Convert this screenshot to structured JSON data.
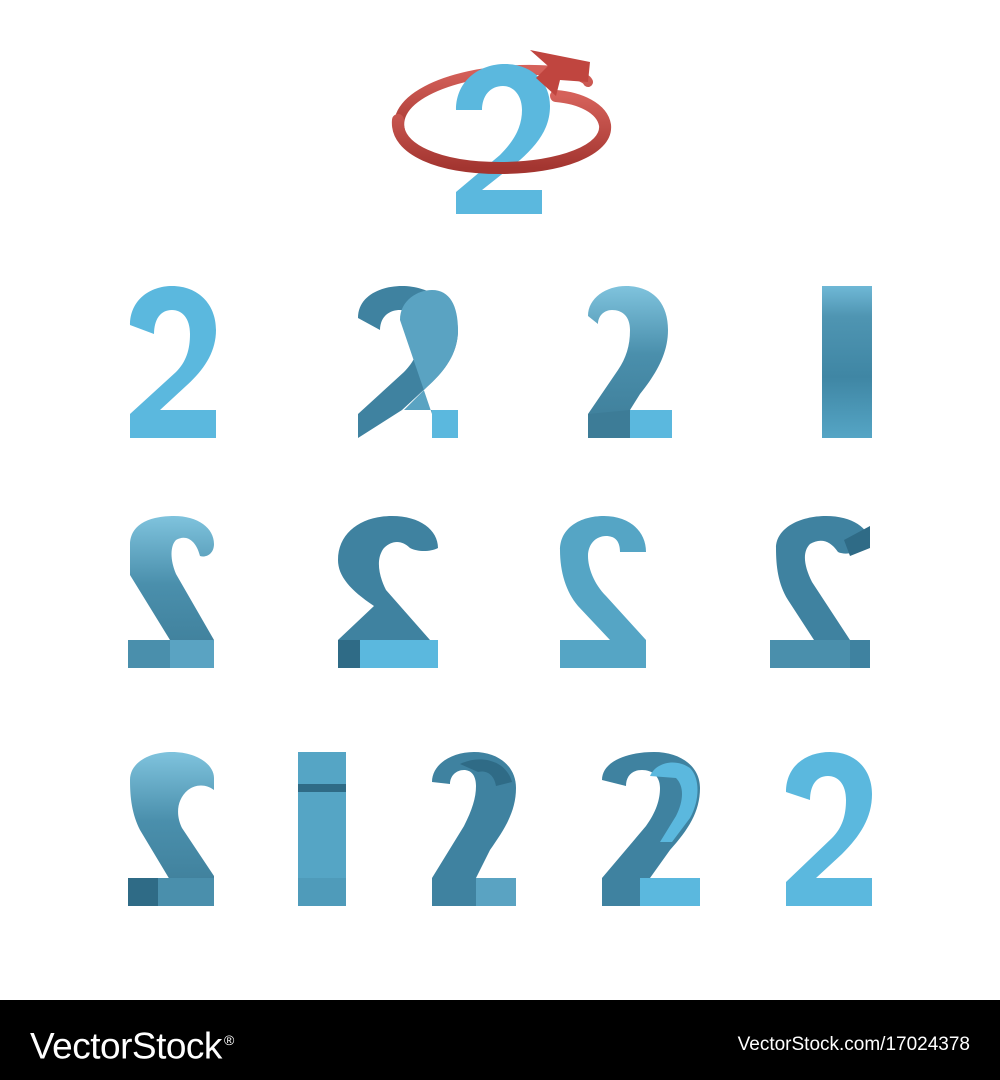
{
  "hero": {
    "digit": "2",
    "arrow_color": "#c0453f",
    "arrow_highlight": "#d5615a"
  },
  "colors": {
    "face": "#5bb8de",
    "face_light": "#62c0e6",
    "side_dark": "#3d7c97",
    "side_mid": "#4a8fac",
    "side_light": "#5aa3c2",
    "top_highlight": "#7fc3dd"
  },
  "frames": [
    {
      "name": "frame-01",
      "view": "front"
    },
    {
      "name": "frame-02",
      "view": "angled-30"
    },
    {
      "name": "frame-03",
      "view": "angled-60"
    },
    {
      "name": "frame-04",
      "view": "edge-on"
    },
    {
      "name": "frame-05",
      "view": "back-angled-60"
    },
    {
      "name": "frame-06",
      "view": "back-angled-30"
    },
    {
      "name": "frame-07",
      "view": "back"
    },
    {
      "name": "frame-08",
      "view": "back-angled-30-other"
    },
    {
      "name": "frame-09",
      "view": "back-angled-60-other"
    },
    {
      "name": "frame-10",
      "view": "edge-on-other"
    },
    {
      "name": "frame-11",
      "view": "angled-60-other"
    },
    {
      "name": "frame-12",
      "view": "angled-30-other"
    },
    {
      "name": "frame-13",
      "view": "front-final"
    }
  ],
  "footer": {
    "brand": "VectorStock",
    "brand_mark": "®",
    "url": "VectorStock.com/17024378"
  }
}
